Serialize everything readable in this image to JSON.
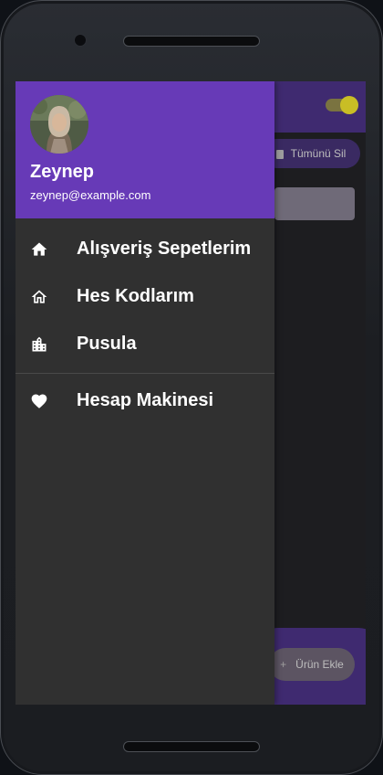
{
  "app_background": {
    "delete_all_label": "Tümünü Sil",
    "add_product_label": "Ürün Ekle"
  },
  "drawer": {
    "user": {
      "name": "Zeynep",
      "email": "zeynep@example.com"
    },
    "items": [
      {
        "label": "Alışveriş Sepetlerim",
        "icon": "home-icon"
      },
      {
        "label": "Hes Kodlarım",
        "icon": "home-outline-icon"
      },
      {
        "label": "Pusula",
        "icon": "building-icon"
      },
      {
        "label": "Hesap Makinesi",
        "icon": "heart-icon"
      }
    ]
  },
  "colors": {
    "header_purple": "#673ab7",
    "drawer_background": "#303030",
    "switch_accent": "#c9be25"
  }
}
